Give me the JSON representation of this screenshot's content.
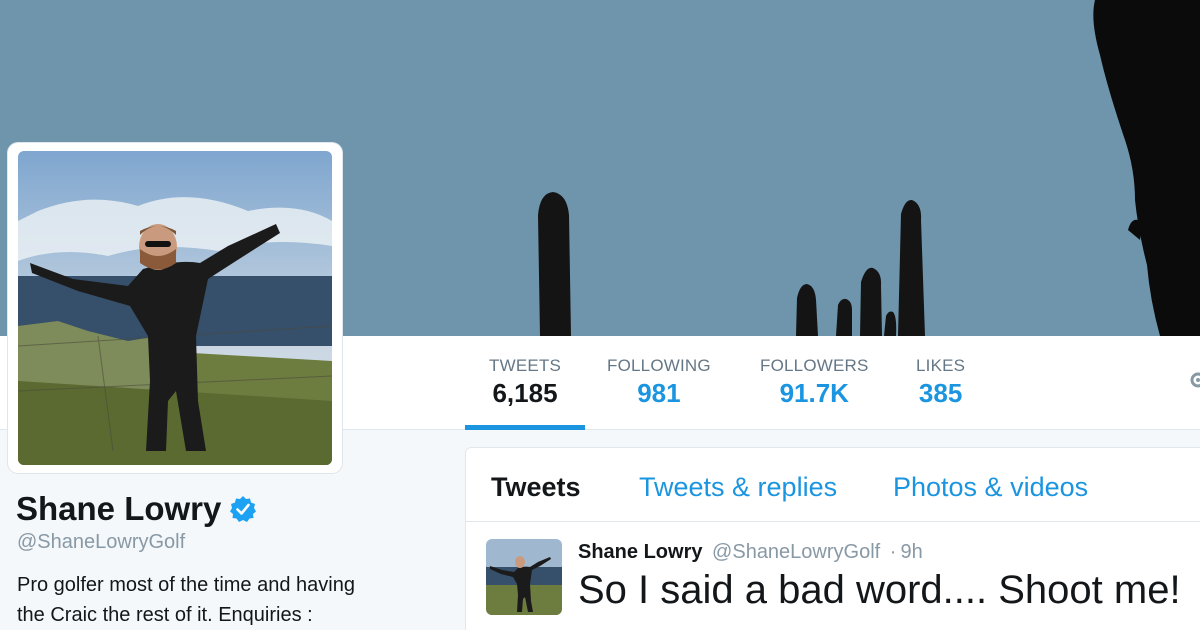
{
  "profile": {
    "name": "Shane Lowry",
    "handle": "@ShaneLowryGolf",
    "bio_line1": "Pro golfer most of the time and having",
    "bio_line2": "the Craic the rest of it. Enquiries :"
  },
  "stats": [
    {
      "label": "TWEETS",
      "value": "6,185"
    },
    {
      "label": "FOLLOWING",
      "value": "981"
    },
    {
      "label": "FOLLOWERS",
      "value": "91.7K"
    },
    {
      "label": "LIKES",
      "value": "385"
    }
  ],
  "tabs": [
    {
      "label": "Tweets"
    },
    {
      "label": "Tweets & replies"
    },
    {
      "label": "Photos & videos"
    }
  ],
  "tweet": {
    "name": "Shane Lowry",
    "handle": "@ShaneLowryGolf",
    "separator": "·",
    "time": "9h",
    "text": "So I said a bad word.... Shoot me!"
  },
  "colors": {
    "accent": "#1b95e0",
    "banner": "#6d94ab",
    "text": "#14171a",
    "muted": "#657786"
  },
  "icons": {
    "verified": "verified-badge-icon",
    "settings": "gear-icon"
  }
}
